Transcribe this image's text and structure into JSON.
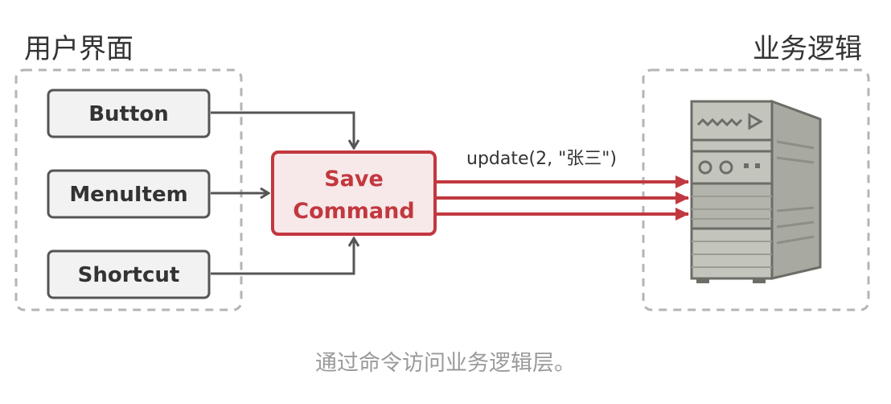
{
  "groups": {
    "ui": {
      "label": "用户界面"
    },
    "business": {
      "label": "业务逻辑"
    }
  },
  "nodes": {
    "button": "Button",
    "menu_item": "MenuItem",
    "shortcut": "Shortcut",
    "command_line1": "Save",
    "command_line2": "Command"
  },
  "edge_label": "update(2, \"张三\")",
  "caption": "通过命令访问业务逻辑层。",
  "colors": {
    "command": "#c2383f",
    "ui_border": "#555555",
    "dashed": "#b5b5b5",
    "server_body": "#b9bbb2",
    "server_dark": "#6b6d66"
  },
  "icons": {
    "server": "server-tower-icon"
  }
}
